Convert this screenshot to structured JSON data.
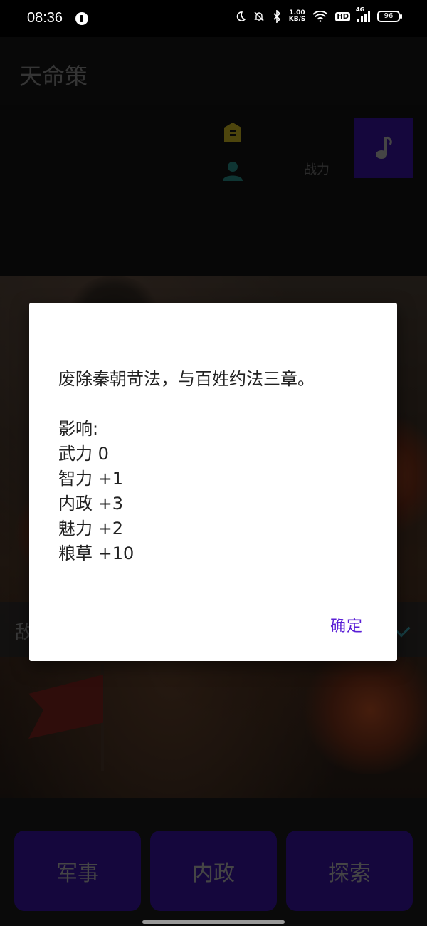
{
  "status_bar": {
    "time": "08:36",
    "net_speed_value": "1.00",
    "net_speed_unit": "KB/S",
    "hd_label": "HD",
    "signal_label": "4G",
    "battery": "96"
  },
  "app_bar": {
    "title": "天命策"
  },
  "header": {
    "power_label": "战力"
  },
  "enemy_strip": {
    "label": "敌"
  },
  "dialog": {
    "message": "废除秦朝苛法，与百姓约法三章。",
    "effects_heading": "影响:",
    "effects": [
      "武力 0",
      "智力 +1",
      "内政 +3",
      "魅力 +2",
      "粮草 +10"
    ],
    "confirm_label": "确定"
  },
  "bottom_nav": {
    "military_label": "军事",
    "politics_label": "内政",
    "explore_label": "探索"
  },
  "colors": {
    "accent_purple": "#2a0f7a",
    "confirm_text": "#5a1fd6",
    "badge_gold": "#9a8a1a",
    "person_teal": "#1f6b66"
  },
  "icons": [
    "moon-icon",
    "mute-bell-icon",
    "bluetooth-icon",
    "wifi-icon",
    "signal-icon",
    "battery-icon",
    "id-badge-icon",
    "person-icon",
    "music-note-icon",
    "check-icon"
  ]
}
